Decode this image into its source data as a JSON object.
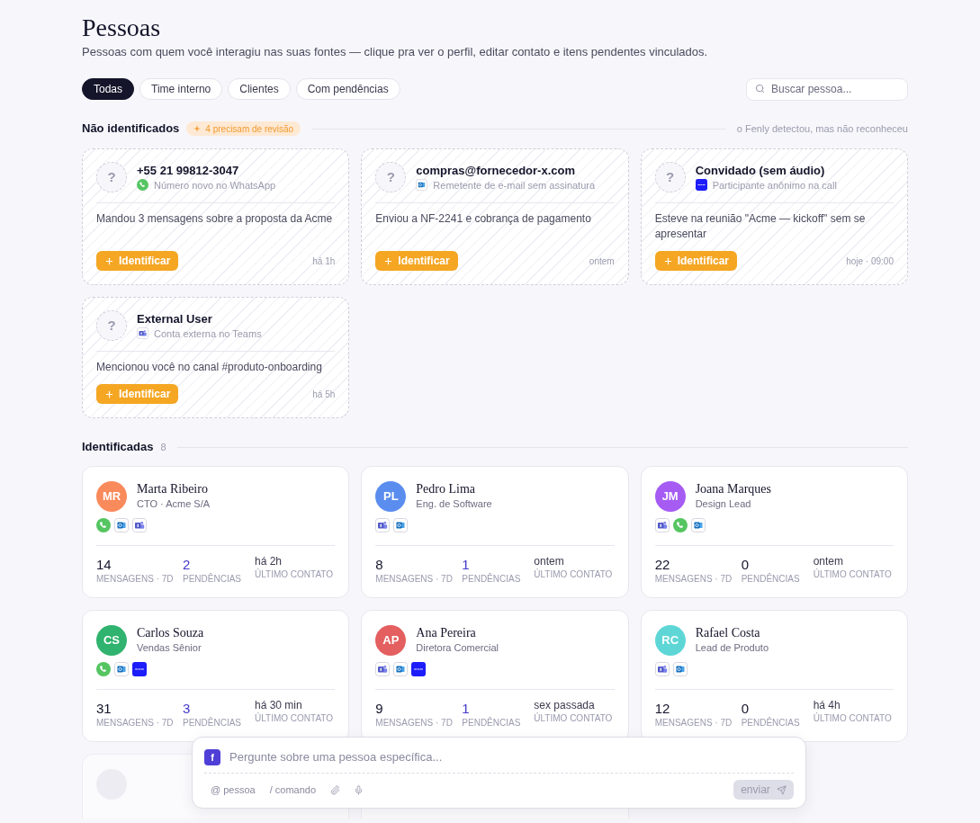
{
  "page": {
    "title": "Pessoas",
    "subtitle": "Pessoas com quem você interagiu nas suas fontes — clique pra ver o perfil, editar contato e itens pendentes vinculados."
  },
  "filters": [
    {
      "label": "Todas",
      "selected": true
    },
    {
      "label": "Time interno",
      "selected": false
    },
    {
      "label": "Clientes",
      "selected": false
    },
    {
      "label": "Com pendências",
      "selected": false
    }
  ],
  "search": {
    "placeholder": "Buscar pessoa..."
  },
  "unidentified": {
    "title": "Não identificados",
    "badge": "4 precisam de revisão",
    "note": "o Fenly detectou, mas não reconheceu",
    "cards": [
      {
        "avatar": "?",
        "name": "+55 21 99812-3047",
        "source": {
          "kind": "chat",
          "label": "Número novo no WhatsApp"
        },
        "description": "Mandou 3 mensagens sobre a proposta da Acme",
        "action": "Identificar",
        "time": "há 1h"
      },
      {
        "avatar": "?",
        "name": "compras@fornecedor-x.com",
        "source": {
          "kind": "mail",
          "label": "Remetente de e-mail sem assinatura"
        },
        "description": "Enviou a NF-2241 e cobrança de pagamento",
        "action": "Identificar",
        "time": "ontem"
      },
      {
        "avatar": "?",
        "name": "Convidado (sem áudio)",
        "source": {
          "kind": "meeting",
          "label": "Participante anônimo na call"
        },
        "description": "Esteve na reunião \"Acme — kickoff\" sem se apresentar",
        "action": "Identificar",
        "time": "hoje · 09:00"
      },
      {
        "avatar": "?",
        "name": "External User",
        "source": {
          "kind": "team",
          "label": "Conta externa no Teams"
        },
        "description": "Mencionou você no canal #produto-onboarding",
        "action": "Identificar",
        "time": "há 5h"
      }
    ]
  },
  "identified": {
    "title": "Identificadas",
    "count": "8",
    "people": [
      {
        "initials": "MR",
        "color": "#f98a5c",
        "name": "Marta Ribeiro",
        "role": "CTO · Acme S/A",
        "channels": [
          {
            "kind": "chat"
          },
          {
            "kind": "mail"
          },
          {
            "kind": "team"
          }
        ],
        "stats": [
          {
            "kind": "count",
            "value": "14",
            "label": "MENSAGENS · 7D",
            "highlighted": false
          },
          {
            "kind": "count",
            "value": "2",
            "label": "PENDÊNCIAS",
            "highlighted": true
          },
          {
            "kind": "time",
            "value": "há 2h",
            "label": "ÚLTIMO CONTATO",
            "highlighted": false
          }
        ]
      },
      {
        "initials": "PL",
        "color": "#5b8def",
        "name": "Pedro Lima",
        "role": "Eng. de Software",
        "channels": [
          {
            "kind": "team"
          },
          {
            "kind": "mail"
          }
        ],
        "stats": [
          {
            "kind": "count",
            "value": "8",
            "label": "MENSAGENS · 7D",
            "highlighted": false
          },
          {
            "kind": "count",
            "value": "1",
            "label": "PENDÊNCIAS",
            "highlighted": true
          },
          {
            "kind": "time",
            "value": "ontem",
            "label": "ÚLTIMO CONTATO",
            "highlighted": false
          }
        ]
      },
      {
        "initials": "JM",
        "color": "#a65cf3",
        "name": "Joana Marques",
        "role": "Design Lead",
        "channels": [
          {
            "kind": "team"
          },
          {
            "kind": "chat"
          },
          {
            "kind": "mail"
          }
        ],
        "stats": [
          {
            "kind": "count",
            "value": "22",
            "label": "MENSAGENS · 7D",
            "highlighted": false
          },
          {
            "kind": "count",
            "value": "0",
            "label": "PENDÊNCIAS",
            "highlighted": false
          },
          {
            "kind": "time",
            "value": "ontem",
            "label": "ÚLTIMO CONTATO",
            "highlighted": false
          }
        ]
      },
      {
        "initials": "CS",
        "color": "#2fb36e",
        "name": "Carlos Souza",
        "role": "Vendas Sênior",
        "channels": [
          {
            "kind": "chat"
          },
          {
            "kind": "mail"
          },
          {
            "kind": "meeting"
          }
        ],
        "stats": [
          {
            "kind": "count",
            "value": "31",
            "label": "MENSAGENS · 7D",
            "highlighted": false
          },
          {
            "kind": "count",
            "value": "3",
            "label": "PENDÊNCIAS",
            "highlighted": true
          },
          {
            "kind": "time",
            "value": "há 30 min",
            "label": "ÚLTIMO CONTATO",
            "highlighted": false
          }
        ]
      },
      {
        "initials": "AP",
        "color": "#e45f5f",
        "name": "Ana Pereira",
        "role": "Diretora Comercial",
        "channels": [
          {
            "kind": "team"
          },
          {
            "kind": "mail"
          },
          {
            "kind": "meeting"
          }
        ],
        "stats": [
          {
            "kind": "count",
            "value": "9",
            "label": "MENSAGENS · 7D",
            "highlighted": false
          },
          {
            "kind": "count",
            "value": "1",
            "label": "PENDÊNCIAS",
            "highlighted": true
          },
          {
            "kind": "time",
            "value": "sex passada",
            "label": "ÚLTIMO CONTATO",
            "highlighted": false
          }
        ]
      },
      {
        "initials": "RC",
        "color": "#5ed6d6",
        "name": "Rafael Costa",
        "role": "Lead de Produto",
        "channels": [
          {
            "kind": "team"
          },
          {
            "kind": "mail"
          }
        ],
        "stats": [
          {
            "kind": "count",
            "value": "12",
            "label": "MENSAGENS · 7D",
            "highlighted": false
          },
          {
            "kind": "count",
            "value": "0",
            "label": "PENDÊNCIAS",
            "highlighted": false
          },
          {
            "kind": "time",
            "value": "há 4h",
            "label": "ÚLTIMO CONTATO",
            "highlighted": false
          }
        ]
      }
    ]
  },
  "composer": {
    "logo": "f",
    "placeholder": "Pergunte sobre uma pessoa específica...",
    "tools": [
      {
        "kind": "text",
        "label": "@ pessoa"
      },
      {
        "kind": "text",
        "label": "/ comando"
      },
      {
        "kind": "attach"
      },
      {
        "kind": "mic"
      }
    ],
    "send": {
      "label": "enviar",
      "disabled": true
    }
  }
}
